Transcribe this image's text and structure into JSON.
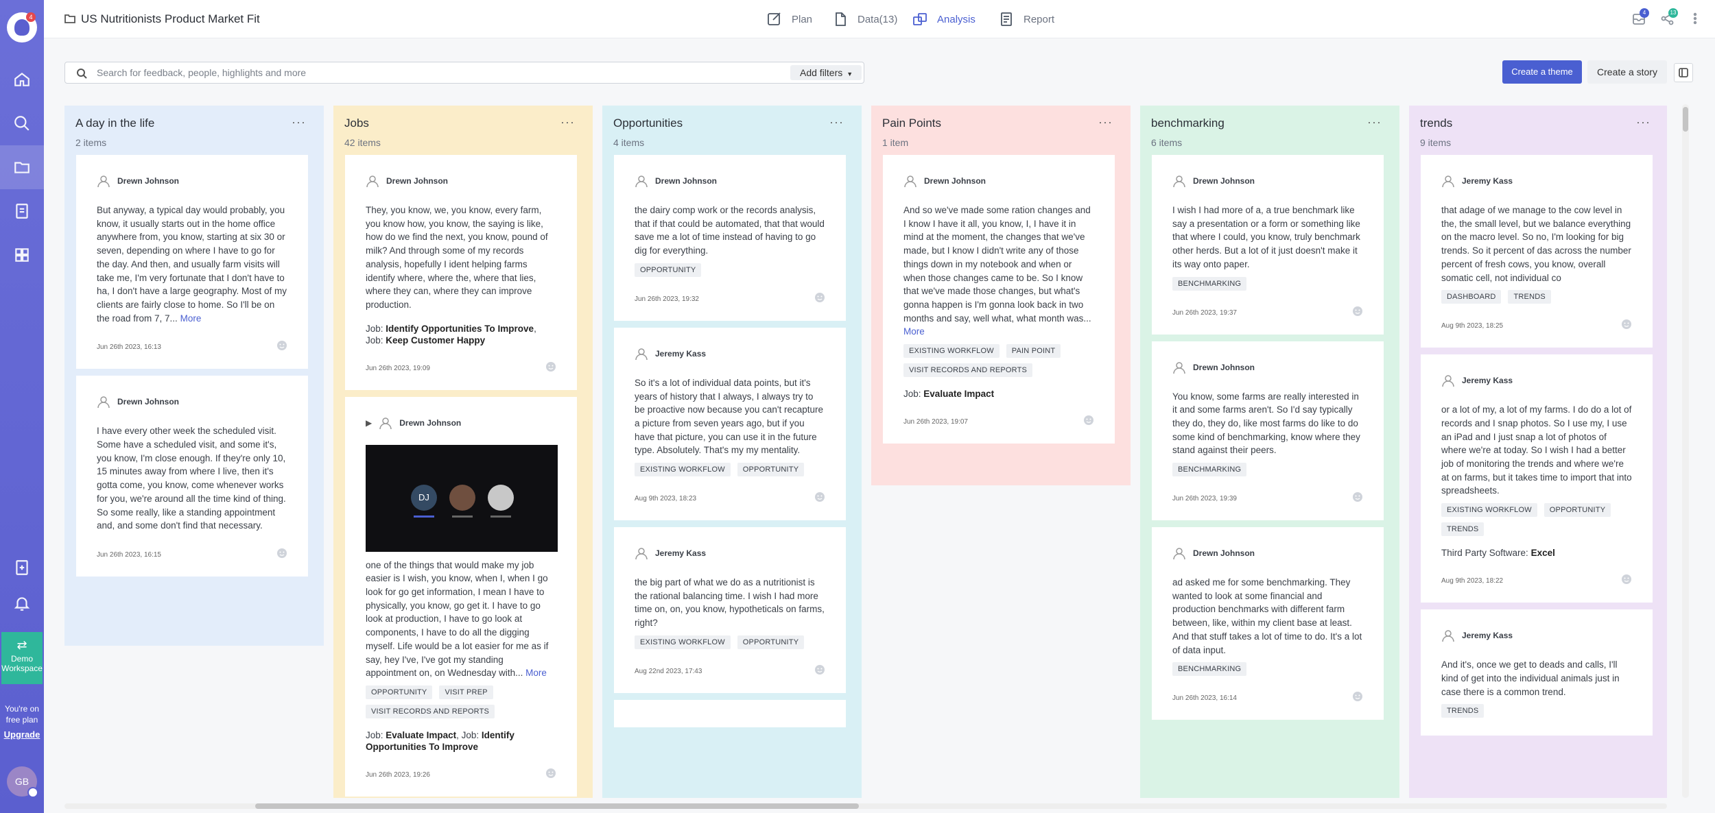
{
  "app": {
    "logo_badge": "4"
  },
  "project": {
    "title": "US Nutritionists Product Market Fit"
  },
  "tabs": [
    {
      "label": "Plan",
      "icon": "plan-icon"
    },
    {
      "label": "Data(13)",
      "icon": "data-icon"
    },
    {
      "label": "Analysis",
      "icon": "analysis-icon",
      "active": true
    },
    {
      "label": "Report",
      "icon": "report-icon"
    }
  ],
  "top_right": {
    "notifications_badge": "4",
    "share_badge": "13"
  },
  "sidebar": {
    "items": [
      "home-icon",
      "search-icon",
      "folder-icon",
      "document-icon",
      "dashboard-icon",
      "add-doc-icon",
      "bell-icon"
    ],
    "demo_label": "Demo Workspace",
    "plan_text": "You're on free plan",
    "upgrade_label": "Upgrade",
    "avatar_initials": "GB"
  },
  "search": {
    "placeholder": "Search for feedback, people, highlights and more",
    "filters_label": "Add filters"
  },
  "actions": {
    "create_theme": "Create a theme",
    "create_story": "Create a story"
  },
  "colors": {
    "accent": "#4a5fd1",
    "col_day": "#e3edfa",
    "col_jobs": "#fbedc9",
    "col_opps": "#d9f0f5",
    "col_pain": "#fde0df",
    "col_bench": "#daf3e6",
    "col_trends": "#eee2f6"
  },
  "columns": [
    {
      "title": "A day in the life",
      "count": "2 items",
      "cards": [
        {
          "author": "Drewn Johnson",
          "text": "But anyway, a typical day would probably, you know, it usually starts out in the home office anywhere from, you know, starting at six 30 or seven, depending on where I have to go for the day. And then, and usually farm visits will take me, I'm very fortunate that I don't have to ha, I don't have a large geography. Most of my clients are fairly close to home. So I'll be on the road from 7, 7...",
          "more": "More",
          "date": "Jun 26th 2023, 16:13"
        },
        {
          "author": "Drewn Johnson",
          "text": "I have every other week the scheduled visit. Some have a scheduled visit, and some it's, you know, I'm close enough. If they're only 10, 15 minutes away from where I live, then it's gotta come, you know, come whenever works for you, we're around all the time kind of thing. So some really, like a standing appointment and, and some don't find that necessary.",
          "date": "Jun 26th 2023, 16:15"
        }
      ]
    },
    {
      "title": "Jobs",
      "count": "42 items",
      "cards": [
        {
          "author": "Drewn Johnson",
          "text": "They, you know, we, you know, every farm, you know how, you know, the saying is like, how do we find the next, you know, pound of milk? And through some of my records analysis, hopefully I ident helping farms identify where, where the, where that lies, where they can, where they can improve production.",
          "job_prefix": "Job:",
          "job1": "Identify Opportunities To Improve",
          "job_sep": ", ",
          "job2": "Keep Customer Happy",
          "date": "Jun 26th 2023, 19:09"
        },
        {
          "author": "Drewn Johnson",
          "video_initials": "DJ",
          "text": "one of the things that would make my job easier is I wish, you know, when I, when I go look for go get information, I mean I have to physically, you know, go get it. I have to go look at production, I have to go look at components, I have to do all the digging myself. Life would be a lot easier for me as if say, hey I've, I've got my standing appointment on, on Wednesday with...",
          "more": "More",
          "tags": [
            "OPPORTUNITY",
            "VISIT PREP",
            "VISIT RECORDS AND REPORTS"
          ],
          "job_prefix": "Job:",
          "job1": "Evaluate Impact",
          "job_sep": ", ",
          "job2": "Identify Opportunities To Improve",
          "date": "Jun 26th 2023, 19:26"
        }
      ]
    },
    {
      "title": "Opportunities",
      "count": "4 items",
      "cards": [
        {
          "author": "Drewn Johnson",
          "text": "the dairy comp work or the records analysis, that if that could be automated, that that would save me a lot of time instead of having to go dig for everything.",
          "tags": [
            "OPPORTUNITY"
          ],
          "date": "Jun 26th 2023, 19:32"
        },
        {
          "author": "Jeremy Kass",
          "text": "So it's a lot of individual data points, but it's years of history that I always, I always try to be proactive now because you can't recapture a picture from seven years ago, but if you have that picture, you can use it in the future type. Absolutely. That's my my mentality.",
          "tags": [
            "EXISTING WORKFLOW",
            "OPPORTUNITY"
          ],
          "date": "Aug 9th 2023, 18:23"
        },
        {
          "author": "Jeremy Kass",
          "text": "the big part of what we do as a nutritionist is the rational balancing time. I wish I had more time on, on, you know, hypotheticals on farms, right?",
          "tags": [
            "EXISTING WORKFLOW",
            "OPPORTUNITY"
          ],
          "date": "Aug 22nd 2023, 17:43"
        }
      ]
    },
    {
      "title": "Pain Points",
      "count": "1 item",
      "cards": [
        {
          "author": "Drewn Johnson",
          "text": "And so we've made some ration changes and I know I have it all, you know, I, I have it in mind at the moment, the changes that we've made, but I know I didn't write any of those things down in my notebook and when or when those changes came to be. So I know that we've made those changes, but what's gonna happen is I'm gonna look back in two months and say, well what, what month was...",
          "more": "More",
          "tags": [
            "EXISTING WORKFLOW",
            "PAIN POINT",
            "VISIT RECORDS AND REPORTS"
          ],
          "job_prefix": "Job:",
          "job1": "Evaluate Impact",
          "date": "Jun 26th 2023, 19:07"
        }
      ]
    },
    {
      "title": "benchmarking",
      "count": "6 items",
      "cards": [
        {
          "author": "Drewn Johnson",
          "text": "I wish I had more of a, a true benchmark like say a presentation or a form or something like that where I could, you know, truly benchmark other herds. But a lot of it just doesn't make it its way onto paper.",
          "tags": [
            "BENCHMARKING"
          ],
          "date": "Jun 26th 2023, 19:37"
        },
        {
          "author": "Drewn Johnson",
          "text": "You know, some farms are really interested in it and some farms aren't. So I'd say typically they do, they do, like most farms do like to do some kind of benchmarking, know where they stand against their peers.",
          "tags": [
            "BENCHMARKING"
          ],
          "date": "Jun 26th 2023, 19:39"
        },
        {
          "author": "Drewn Johnson",
          "text": "ad asked me for some benchmarking. They wanted to look at some financial and production benchmarks with different farm between, like, within my client base at least. And that stuff takes a lot of time to do. It's a lot of data input.",
          "tags": [
            "BENCHMARKING"
          ],
          "date": "Jun 26th 2023, 16:14"
        }
      ]
    },
    {
      "title": "trends",
      "count": "9 items",
      "cards": [
        {
          "author": "Jeremy Kass",
          "text": "that adage of we manage to the cow level in the, the small level, but we balance everything on the macro level. So no, I'm looking for big trends. So it percent of das across the number percent of fresh cows, you know, overall somatic cell, not individual co",
          "tags": [
            "DASHBOARD",
            "TRENDS"
          ],
          "date": "Aug 9th 2023, 18:25"
        },
        {
          "author": "Jeremy Kass",
          "text": "or a lot of my, a lot of my farms. I do do a lot of records and I snap photos. So I use my, I use an iPad and I just snap a lot of photos of where we're at today. So I wish I had a better job of monitoring the trends and where we're at on farms, but it takes time to import that into spreadsheets.",
          "tags": [
            "EXISTING WORKFLOW",
            "OPPORTUNITY",
            "TRENDS"
          ],
          "software_prefix": "Third Party Software:",
          "software": "Excel",
          "date": "Aug 9th 2023, 18:22"
        },
        {
          "author": "Jeremy Kass",
          "text": "And it's, once we get to deads and calls, I'll kind of get into the individual animals just in case there is a common trend.",
          "tags": [
            "TRENDS"
          ]
        }
      ]
    }
  ]
}
